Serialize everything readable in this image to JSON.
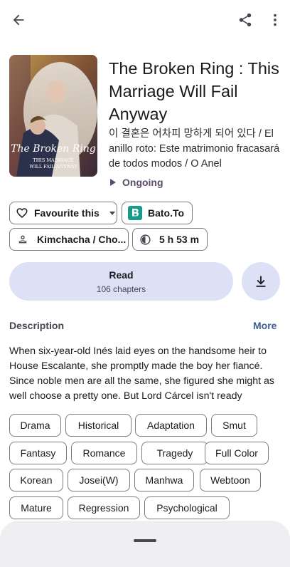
{
  "manga": {
    "title": "The Broken Ring : This Marriage Will Fail Anyway",
    "alt_titles": "이 결혼은 어차피 망하게 되어 있다 / El anillo roto: Este matrimonio fracasará de todos modos / O Anel",
    "status": "Ongoing",
    "cover_text": {
      "line1": "The Broken Ring",
      "line2": "THIS MARRIAGE",
      "line3": "WILL FAIL ANYWAY"
    }
  },
  "actions": {
    "favourite_label": "Favourite this",
    "source_label": "Bato.To",
    "author_label": "Kimchacha / Cho...",
    "time_label": "5 h 53 m",
    "read_label": "Read",
    "read_sub": "106 chapters"
  },
  "description": {
    "heading": "Description",
    "more_label": "More",
    "text": "When six-year-old Inés laid eyes on the handsome heir to House Escalante, she promptly made the boy her fiancé. Since noble men are all the same, she figured she might as well choose a pretty one. But Lord Cárcel isn't ready"
  },
  "tags": [
    "Drama",
    "Historical",
    "Adaptation",
    "Smut",
    "Fantasy",
    "Romance",
    "Tragedy",
    "Full Color",
    "Korean",
    "Josei(W)",
    "Manhwa",
    "Webtoon",
    "Mature",
    "Regression",
    "Psychological"
  ],
  "icons": {
    "back": "arrow-back-icon",
    "share": "share-icon",
    "overflow": "more-vert-icon",
    "favourite": "heart-outline-icon",
    "source": "source-logo-icon",
    "author": "person-icon",
    "time": "timer-icon",
    "download": "download-icon",
    "status": "play-triangle-icon"
  },
  "colors": {
    "accent_container": "#dce1f6",
    "link": "#3e5f8f",
    "source_logo": "#1a9a8a",
    "status": "#5b4a6a"
  }
}
